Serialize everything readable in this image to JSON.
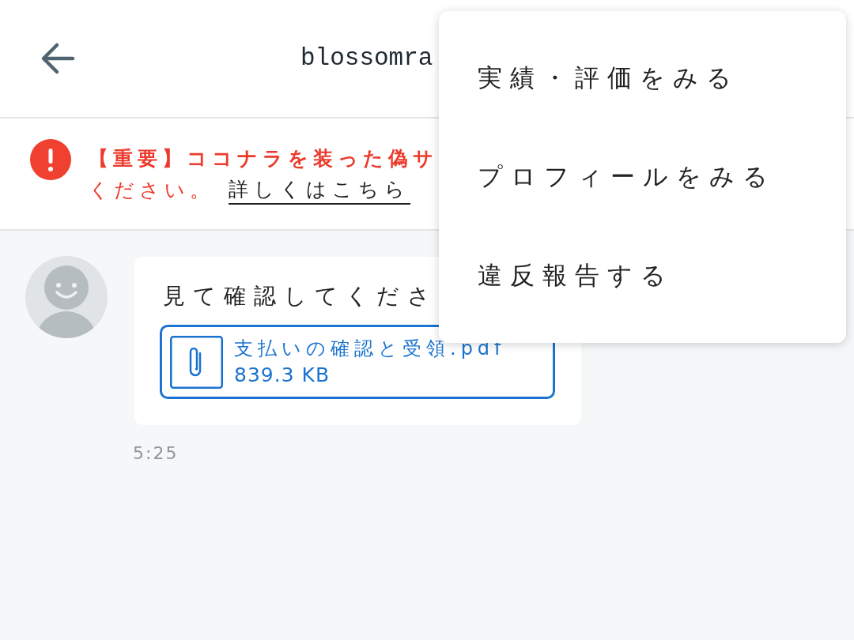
{
  "header": {
    "title": "blossomra"
  },
  "alert": {
    "lines": [
      "【重要】ココナラを装った偽サ",
      "ください。"
    ],
    "link": "詳しくはこちら"
  },
  "messages": [
    {
      "text": "見て確認してくださ",
      "attachment": {
        "name": "支払いの確認と受領.pdf",
        "size": "839.3 KB"
      },
      "time": "5:25"
    }
  ],
  "menu": {
    "items": [
      {
        "label": "実績・評価をみる"
      },
      {
        "label": "プロフィールをみる"
      },
      {
        "label": "違反報告する"
      }
    ]
  }
}
